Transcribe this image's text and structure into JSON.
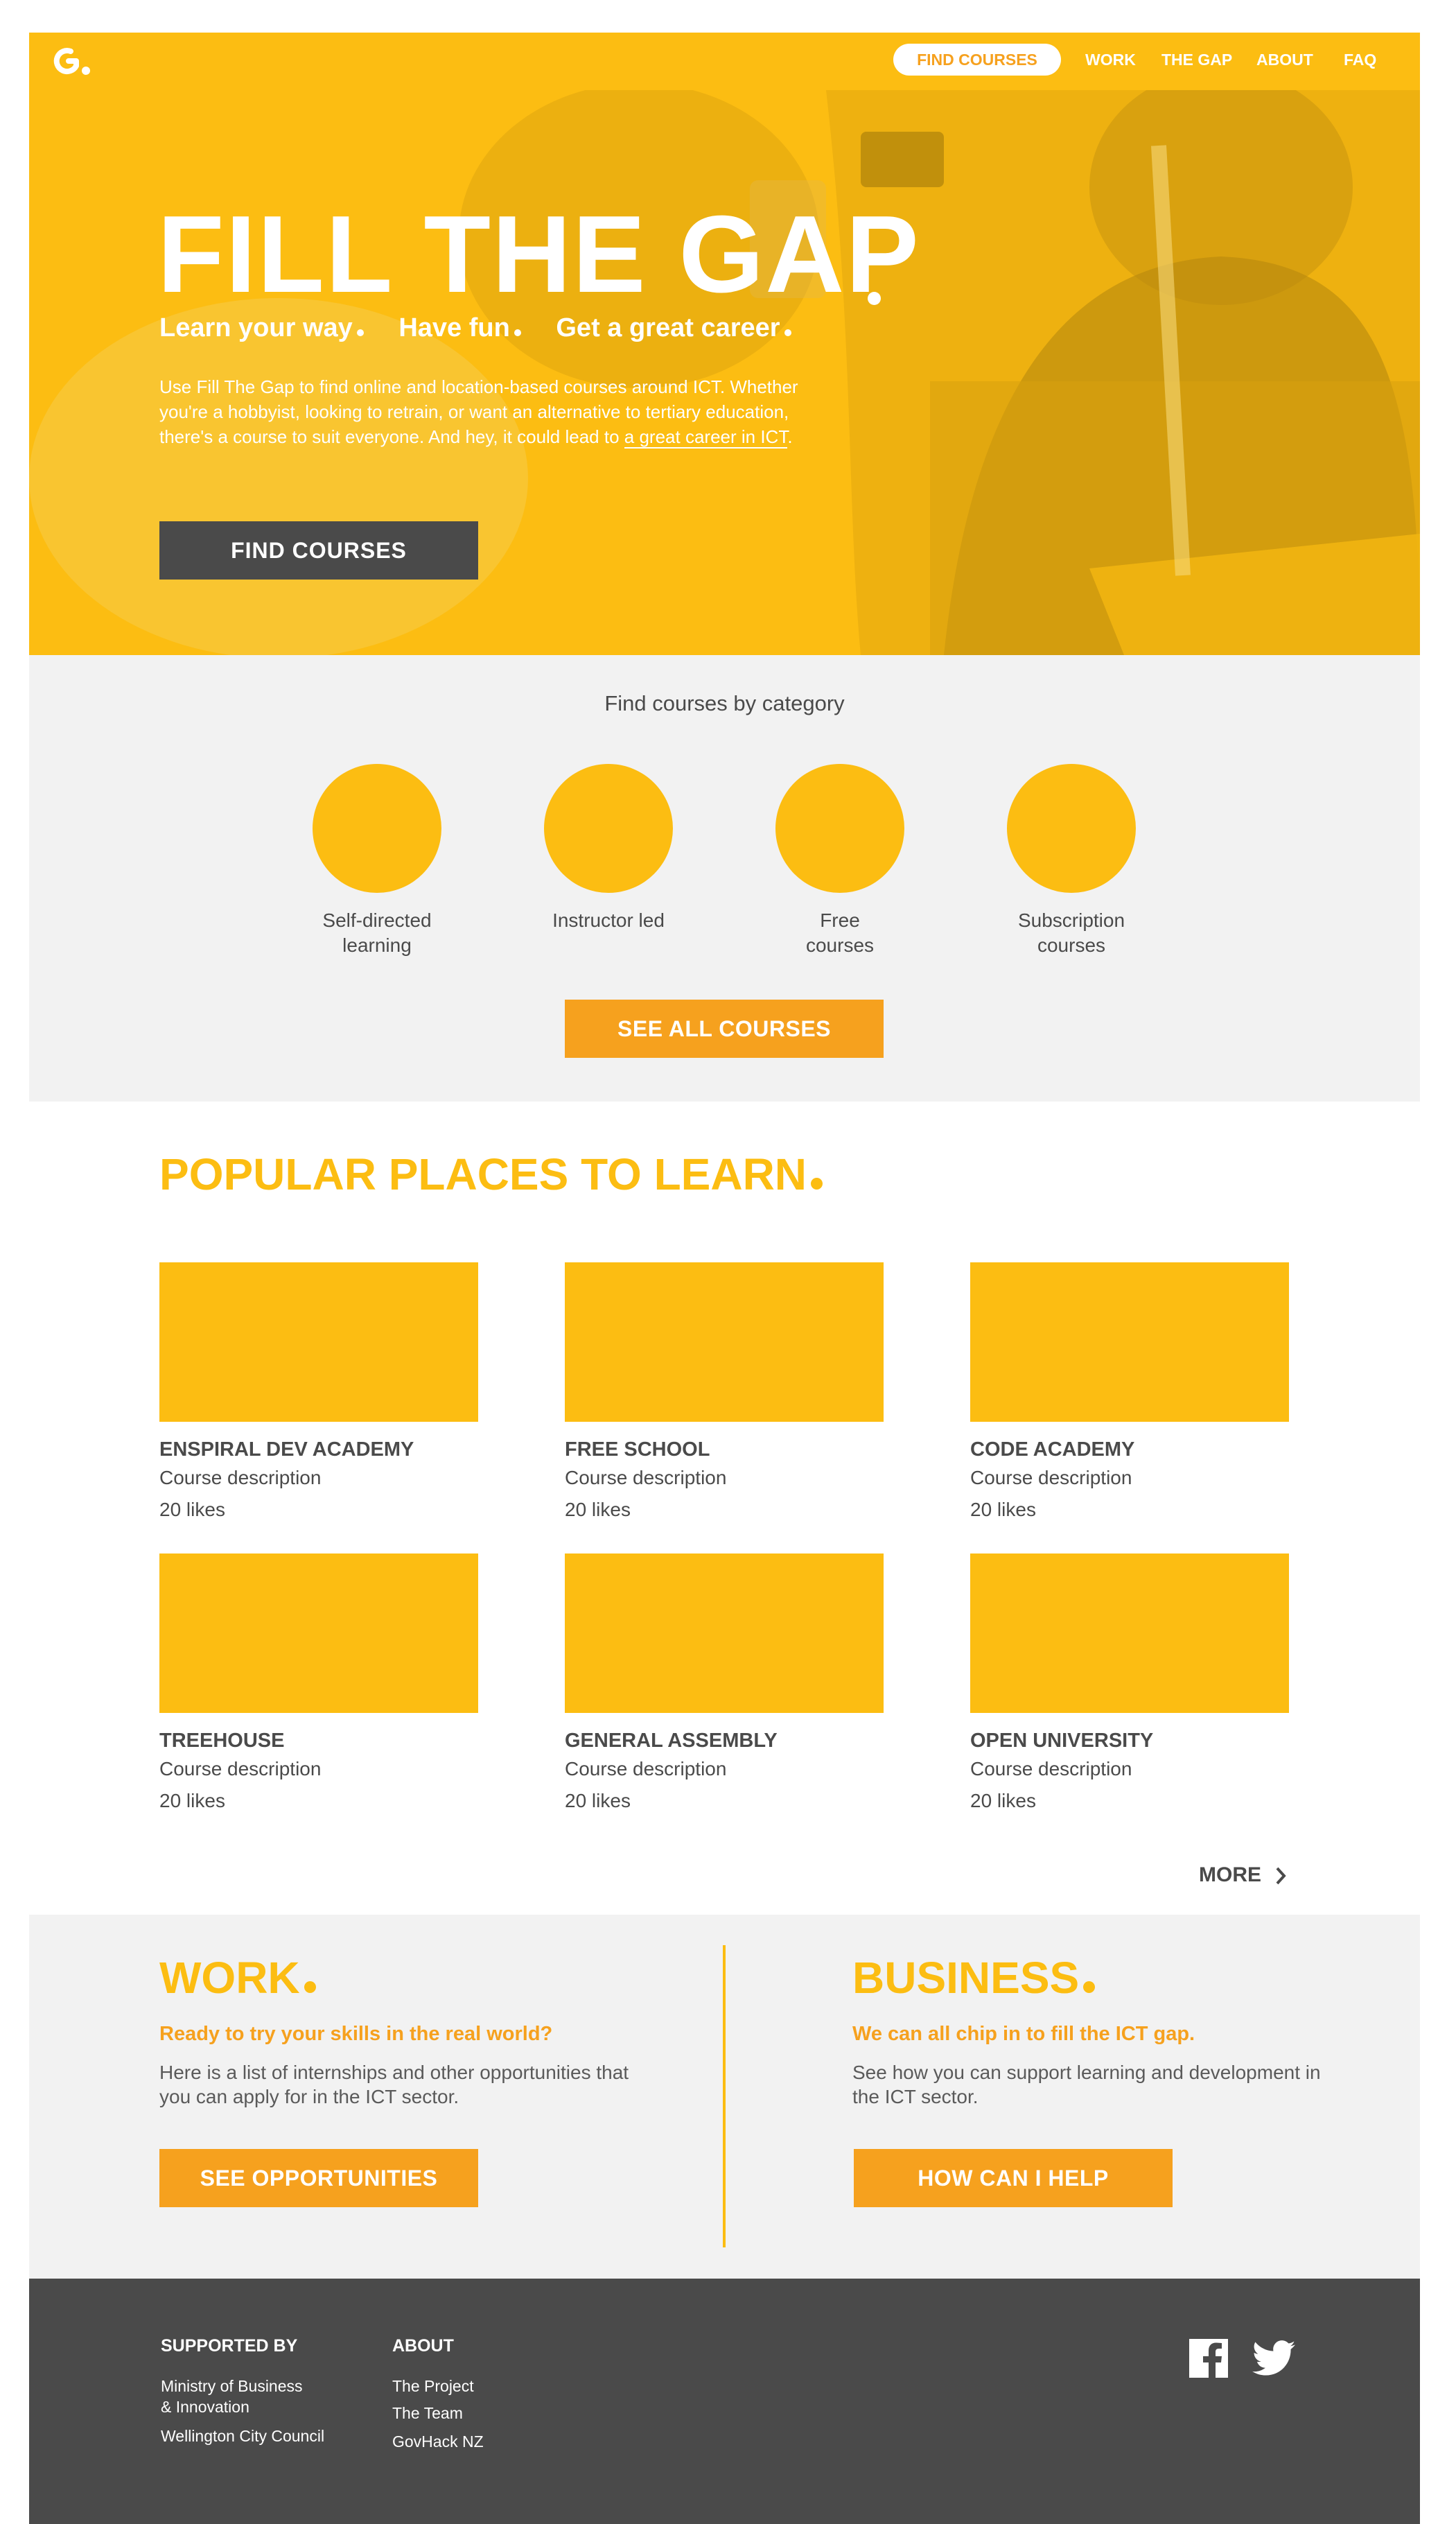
{
  "nav": {
    "logo": "G.",
    "find_courses": "FIND COURSES",
    "links": [
      "WORK",
      "THE GAP",
      "ABOUT",
      "FAQ"
    ]
  },
  "hero": {
    "title": "FILL THE GAP",
    "tagline": [
      "Learn your way",
      "Have fun",
      "Get a great career"
    ],
    "description": "Use Fill The Gap to find online and location-based courses around ICT. Whether you're a hobbyist, looking to retrain, or want an alternative to tertiary education, there's a course to suit everyone. And hey, it could lead to ",
    "description_link": "a great career in ICT",
    "button": "FIND COURSES"
  },
  "categories": {
    "title": "Find courses by category",
    "items": [
      {
        "label": "Self-directed\nlearning"
      },
      {
        "label": "Instructor led"
      },
      {
        "label": "Free\ncourses"
      },
      {
        "label": "Subscription\ncourses"
      }
    ],
    "button": "SEE ALL COURSES"
  },
  "popular": {
    "title": "POPULAR PLACES TO LEARN",
    "cards": [
      {
        "name": "ENSPIRAL DEV ACADEMY",
        "description": "Course description",
        "likes": "20 likes"
      },
      {
        "name": "FREE SCHOOL",
        "description": "Course description",
        "likes": "20 likes"
      },
      {
        "name": "CODE ACADEMY",
        "description": "Course description",
        "likes": "20 likes"
      },
      {
        "name": "TREEHOUSE",
        "description": "Course description",
        "likes": "20 likes"
      },
      {
        "name": "GENERAL ASSEMBLY",
        "description": "Course description",
        "likes": "20 likes"
      },
      {
        "name": "OPEN UNIVERSITY",
        "description": "Course description",
        "likes": "20 likes"
      }
    ],
    "more": "MORE"
  },
  "work": {
    "title": "WORK",
    "subtitle": "Ready to try your skills in the real world?",
    "text": "Here is a list of internships and other opportunities that you can apply for in the ICT sector.",
    "button": "SEE OPPORTUNITIES"
  },
  "business": {
    "title": "BUSINESS",
    "subtitle": "We can all chip in to fill the ICT gap.",
    "text": "See how you can support learning and development in the ICT sector.",
    "button": "HOW CAN I HELP"
  },
  "footer": {
    "supported_heading": "SUPPORTED BY",
    "supported": [
      "Ministry of Business\n& Innovation",
      "Wellington City Council"
    ],
    "about_heading": "ABOUT",
    "about": [
      "The Project",
      "The Team",
      "GovHack NZ"
    ]
  },
  "colors": {
    "brand_yellow": "#fcbd12",
    "accent_orange": "#f6a11e",
    "dark_gray": "#4a4a4a",
    "light_gray": "#f2f2f2"
  },
  "icons": [
    "logo-icon",
    "chevron-right-icon",
    "facebook-icon",
    "twitter-icon"
  ]
}
